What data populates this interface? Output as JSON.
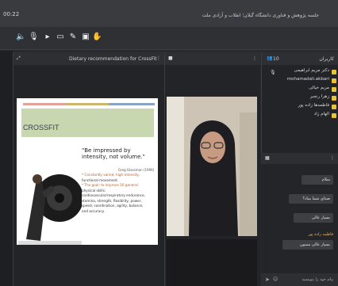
{
  "titlebar": {
    "time": "00:22",
    "title": "جلسه پژوهش و فناوری دانشگاه گیلان؛ انقلاب و آزادی ملت"
  },
  "slide_panel": {
    "title": "Dietary recommendation for CrossFit"
  },
  "slide": {
    "heading": "CROSSFIT",
    "quote": "\"Be impressed by intensity, not volume.\"",
    "author": "Greg Glassman (1996)",
    "body_lines": [
      "* Constantly varied, high-intensity,",
      "functional movement.",
      "* The goal: to improve 10 general",
      "physical skills:",
      "cardiovascular/respiratory endurance,",
      "stamina, strength, flexibility, power,",
      "speed, coordination, agility, balance,",
      "and accuracy."
    ]
  },
  "users_panel": {
    "count_label": "10",
    "title": "کاربران",
    "users": [
      "دکتر مریم ابراهیمی",
      "mohamadali.akbari",
      "مریم خیالی",
      "زهرا رنجبر",
      "فاطمه‌ها زاده پور",
      "الهام زاد"
    ]
  },
  "chat": {
    "messages": [
      "سلام",
      "صدای شما میاد؟",
      "بسیار عالی",
      "بسیار عالی ممنون"
    ],
    "sender": "فاطمه زاده پور",
    "input_placeholder": "پیام خود را بنویسید"
  }
}
